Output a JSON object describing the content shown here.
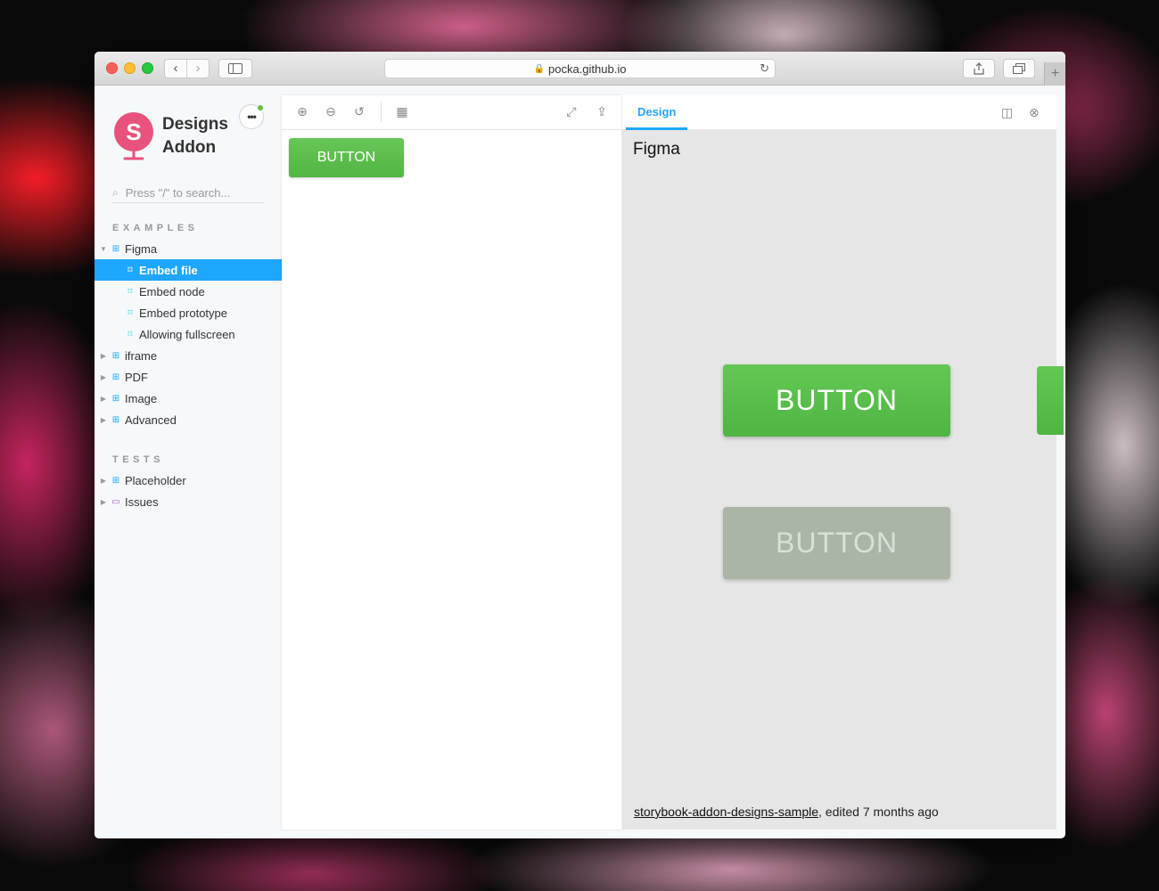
{
  "browser": {
    "url": "pocka.github.io",
    "back_icon": "chevron-left-icon",
    "forward_icon": "chevron-right-icon",
    "new_tab_label": "+"
  },
  "sidebar": {
    "brand_line1": "Designs",
    "brand_line2": "Addon",
    "more_label": "•••",
    "search_placeholder": "Press \"/\" to search...",
    "sections": [
      {
        "title": "EXAMPLES"
      },
      {
        "title": "TESTS"
      }
    ],
    "items": [
      {
        "label": "Figma",
        "type": "component",
        "expanded": true
      },
      {
        "label": "Embed file",
        "type": "story",
        "selected": true
      },
      {
        "label": "Embed node",
        "type": "story"
      },
      {
        "label": "Embed prototype",
        "type": "story"
      },
      {
        "label": "Allowing fullscreen",
        "type": "story"
      },
      {
        "label": "iframe",
        "type": "component"
      },
      {
        "label": "PDF",
        "type": "component"
      },
      {
        "label": "Image",
        "type": "component"
      },
      {
        "label": "Advanced",
        "type": "component"
      },
      {
        "label": "Placeholder",
        "type": "component"
      },
      {
        "label": "Issues",
        "type": "folder"
      }
    ]
  },
  "canvas": {
    "button_label": "BUTTON"
  },
  "design": {
    "tab_label": "Design",
    "embed_title": "Figma",
    "primary_button": "BUTTON",
    "disabled_button": "BUTTON",
    "file_link": "storybook-addon-designs-sample",
    "edited_text": ", edited 7 months ago"
  },
  "colors": {
    "accent": "#1ea7fd",
    "button_green": "#5bbd4b",
    "disabled_grey": "#aab5a6",
    "logo_pink": "#e8537e"
  }
}
